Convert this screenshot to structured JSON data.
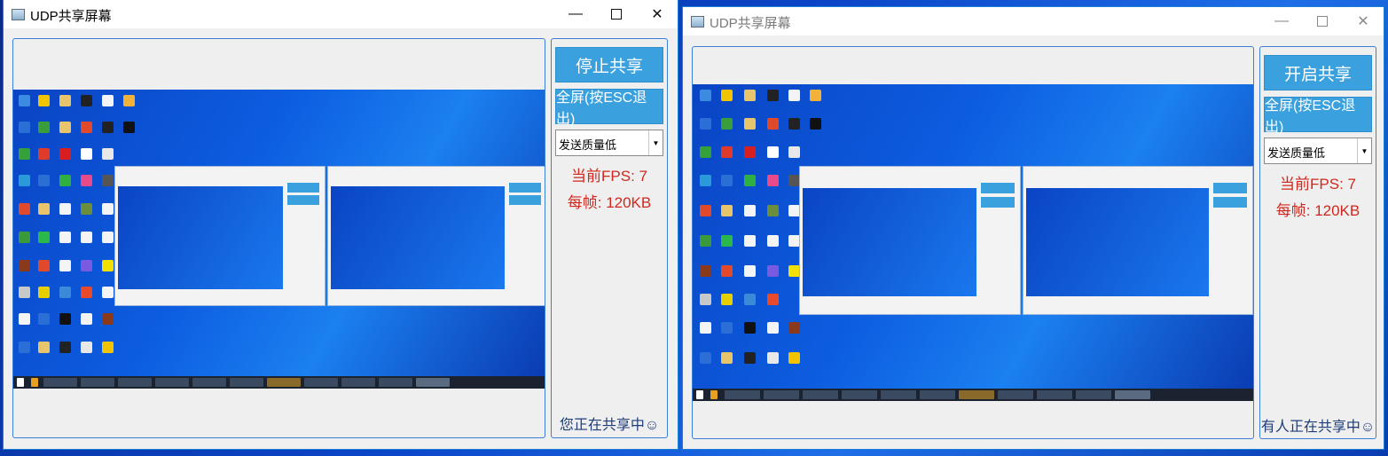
{
  "windows": [
    {
      "title": "UDP共享屏幕",
      "share_button": "停止共享",
      "fullscreen_button": "全屏(按ESC退出)",
      "quality_select": "发送质量低",
      "fps": "当前FPS: 7",
      "frame_size": "每帧: 120KB",
      "status": "您正在共享中☺"
    },
    {
      "title": "UDP共享屏幕",
      "share_button": "开启共享",
      "fullscreen_button": "全屏(按ESC退出)",
      "quality_select": "发送质量低",
      "fps": "当前FPS: 7",
      "frame_size": "每帧: 120KB",
      "status": "有人正在共享中☺"
    }
  ],
  "titlebar_icons": [
    "minimize-icon",
    "maximize-icon",
    "close-icon"
  ],
  "colors": {
    "button_blue": "#3aa0de",
    "stat_red": "#d0281e",
    "status_navy": "#1f3c78",
    "frame_border": "#3b7fd6"
  }
}
